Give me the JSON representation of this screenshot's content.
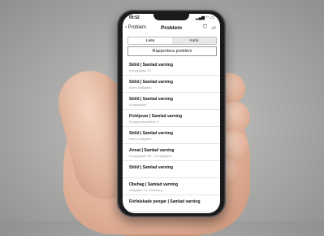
{
  "status_bar": {
    "time": "09:52",
    "icons": "▂▄▆ ◠ ▭"
  },
  "nav": {
    "back_label": "Problem",
    "title": "Problem",
    "filter_icon": "filter-icon",
    "chat_icon": "chat-icon"
  },
  "segments": {
    "list_label": "Lista",
    "map_label": "Karta"
  },
  "report_button": "Rapportera problem",
  "items": [
    {
      "title": "Stöld | Samlad varning",
      "subtitle": "Kungsgatan 10"
    },
    {
      "title": "Stöld | Samlad varning",
      "subtitle": "Norra Vallgatan"
    },
    {
      "title": "Stöld | Samlad varning",
      "subtitle": "Kungsgatan"
    },
    {
      "title": "Ficktjuvar | Samlad varning",
      "subtitle": "Kungsportsplatsen 3"
    },
    {
      "title": "Stöld | Samlad varning",
      "subtitle": "Norra Vallgatan"
    },
    {
      "title": "Annat | Samlad varning",
      "subtitle": "Kungsgatan 48 – Kungsgatan"
    },
    {
      "title": "Stöld | Samlad varning",
      "subtitle": ""
    },
    {
      "title": "Obehag | Samlad varning",
      "subtitle": "Vallgatan 20, Göteborg"
    },
    {
      "title": "Förfalskade pengar | Samlad varning",
      "subtitle": ""
    }
  ]
}
